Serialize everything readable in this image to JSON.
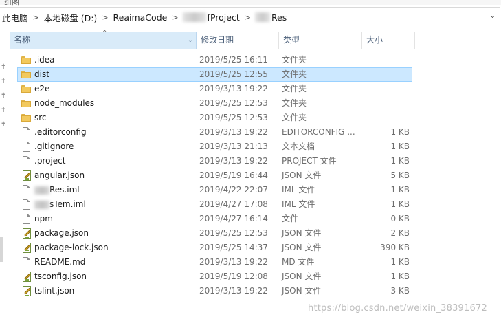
{
  "title_fragment": "组图",
  "breadcrumb": [
    {
      "label": "此电脑"
    },
    {
      "label": "本地磁盘 (D:)"
    },
    {
      "label": "ReaimaCode"
    },
    {
      "label": "fProject",
      "blurred_prefix": true
    },
    {
      "label": "Res",
      "blurred_prefix": true
    }
  ],
  "columns": {
    "name": "名称",
    "date": "修改日期",
    "type": "类型",
    "size": "大小"
  },
  "files": [
    {
      "name": ".idea",
      "date": "2019/5/25 16:11",
      "type": "文件夹",
      "size": "",
      "icon": "folder-icon"
    },
    {
      "name": "dist",
      "date": "2019/5/25 12:55",
      "type": "文件夹",
      "size": "",
      "icon": "folder-icon",
      "selected": true
    },
    {
      "name": "e2e",
      "date": "2019/3/13 19:22",
      "type": "文件夹",
      "size": "",
      "icon": "folder-icon"
    },
    {
      "name": "node_modules",
      "date": "2019/5/25 12:53",
      "type": "文件夹",
      "size": "",
      "icon": "folder-icon"
    },
    {
      "name": "src",
      "date": "2019/5/25 12:53",
      "type": "文件夹",
      "size": "",
      "icon": "folder-icon"
    },
    {
      "name": ".editorconfig",
      "date": "2019/3/13 19:22",
      "type": "EDITORCONFIG ...",
      "size": "1 KB",
      "icon": "file-icon"
    },
    {
      "name": ".gitignore",
      "date": "2019/3/13 21:13",
      "type": "文本文档",
      "size": "1 KB",
      "icon": "file-icon"
    },
    {
      "name": ".project",
      "date": "2019/3/13 19:22",
      "type": "PROJECT 文件",
      "size": "1 KB",
      "icon": "file-icon"
    },
    {
      "name": "angular.json",
      "date": "2019/5/19 16:44",
      "type": "JSON 文件",
      "size": "5 KB",
      "icon": "json-file-icon"
    },
    {
      "name": "Res.iml",
      "date": "2019/4/22 22:07",
      "type": "IML 文件",
      "size": "1 KB",
      "icon": "file-icon",
      "blurred_prefix": true
    },
    {
      "name": "sTem.iml",
      "date": "2019/4/27 17:08",
      "type": "IML 文件",
      "size": "1 KB",
      "icon": "file-icon",
      "blurred_prefix": true
    },
    {
      "name": "npm",
      "date": "2019/4/27 16:14",
      "type": "文件",
      "size": "0 KB",
      "icon": "file-icon"
    },
    {
      "name": "package.json",
      "date": "2019/5/25 12:53",
      "type": "JSON 文件",
      "size": "2 KB",
      "icon": "json-file-icon"
    },
    {
      "name": "package-lock.json",
      "date": "2019/5/25 14:37",
      "type": "JSON 文件",
      "size": "390 KB",
      "icon": "json-file-icon"
    },
    {
      "name": "README.md",
      "date": "2019/3/13 19:22",
      "type": "MD 文件",
      "size": "1 KB",
      "icon": "file-icon"
    },
    {
      "name": "tsconfig.json",
      "date": "2019/5/19 12:08",
      "type": "JSON 文件",
      "size": "1 KB",
      "icon": "json-file-icon"
    },
    {
      "name": "tslint.json",
      "date": "2019/3/13 19:22",
      "type": "JSON 文件",
      "size": "3 KB",
      "icon": "json-file-icon"
    }
  ],
  "watermark": "https://blog.csdn.net/weixin_38391672",
  "colors": {
    "selection": "#cce8ff",
    "header_active": "#d9ebf9",
    "folder": "#f2c95e"
  }
}
